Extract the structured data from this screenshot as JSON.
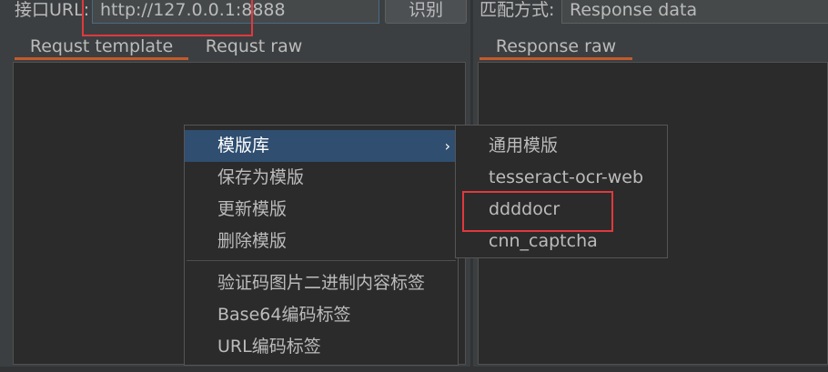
{
  "toolbar": {
    "url_label": "接口URL:",
    "url_value": "http://127.0.0.1:8888",
    "identify_button": "识别",
    "match_label": "匹配方式:",
    "match_value": "Response data"
  },
  "left_tabs": [
    {
      "label": "Requst template",
      "active": true
    },
    {
      "label": "Requst raw",
      "active": false
    }
  ],
  "right_tabs": [
    {
      "label": "Response raw",
      "active": true
    }
  ],
  "context_menu": {
    "items": [
      {
        "label": "模版库",
        "selected": true,
        "submenu_arrow": "›"
      },
      {
        "label": "保存为模版"
      },
      {
        "label": "更新模版"
      },
      {
        "label": "删除模版"
      },
      {
        "label": "验证码图片二进制内容标签"
      },
      {
        "label": "Base64编码标签"
      },
      {
        "label": "URL编码标签"
      }
    ]
  },
  "submenu": {
    "items": [
      {
        "label": "通用模版"
      },
      {
        "label": "tesseract-ocr-web"
      },
      {
        "label": "ddddocr",
        "highlighted": true
      },
      {
        "label": "cnn_captcha"
      }
    ]
  },
  "colors": {
    "background": "#3c3f41",
    "panel": "#2b2b2b",
    "accent_tab": "#c25b2b",
    "menu_selection": "#2f4e70",
    "annotation_red": "#e0393e"
  }
}
